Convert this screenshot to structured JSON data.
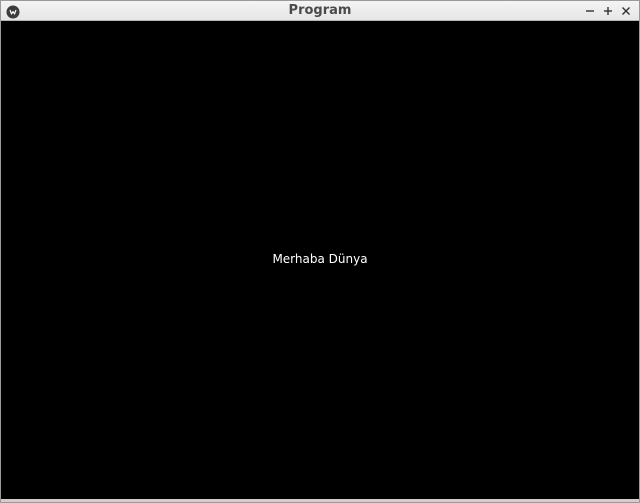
{
  "window": {
    "title": "Program",
    "icon": "app-logo-icon",
    "controls": {
      "minimize_icon": "minimize-icon",
      "maximize_icon": "maximize-icon",
      "close_icon": "close-icon"
    }
  },
  "content": {
    "message": "Merhaba Dünya"
  },
  "colors": {
    "background": "#000000",
    "text": "#ffffff",
    "titlebar": "#ececec",
    "title_text": "#4a4a4a"
  }
}
